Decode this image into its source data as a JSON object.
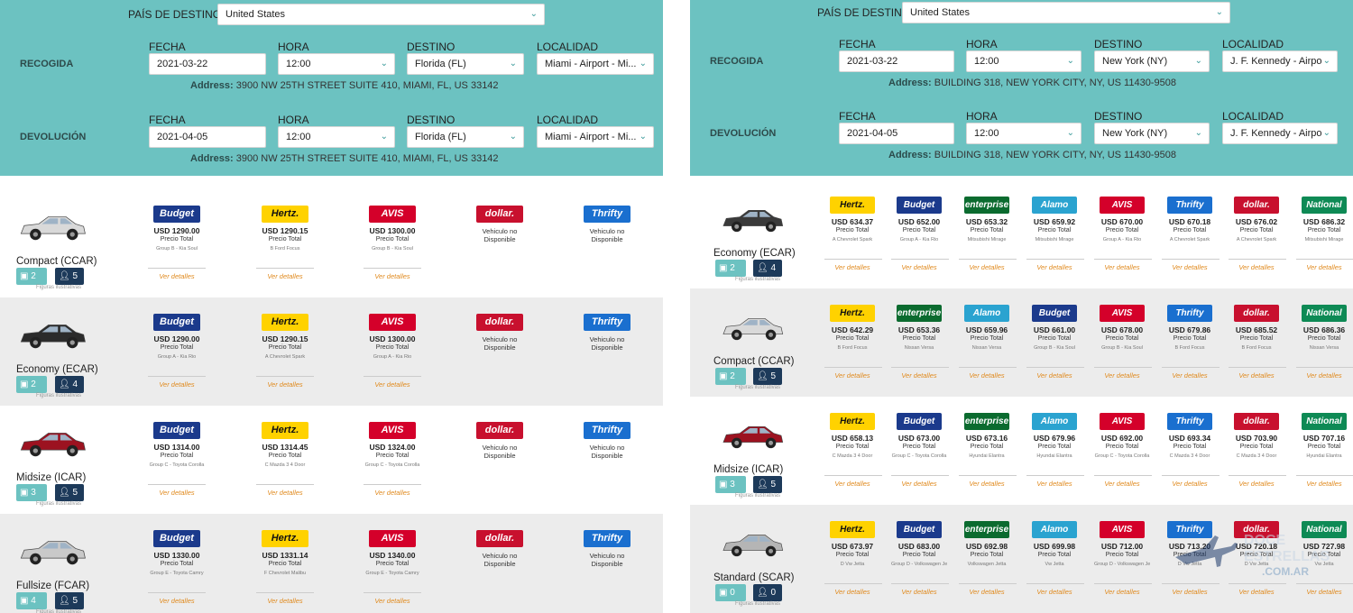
{
  "pickup_label": "RECOGIDA",
  "return_label": "DEVOLUCIÓN",
  "country_label": "PAÍS DE DESTINO",
  "col_labels": {
    "fecha": "FECHA",
    "hora": "HORA",
    "destino": "DESTINO",
    "localidad": "LOCALIDAD"
  },
  "addr_prefix": "Address:",
  "price_label": "Precio Total",
  "details_label": "Ver detalles",
  "no_vehicle_label": "Vehiculo no Disponible",
  "fig_note": "Figuras ilustrativas",
  "brands": {
    "budget": "Budget",
    "hertz": "Hertz.",
    "avis": "AVIS",
    "dollar": "dollar.",
    "thrifty": "Thrifty",
    "enterprise": "enterprise",
    "alamo": "Alamo",
    "national": "National"
  },
  "brand_colors": {
    "budget": "#1b3a8c",
    "hertz": "#ffd200",
    "avis": "#d4002a",
    "dollar": "#c8102e",
    "thrifty": "#1a6fcf",
    "enterprise": "#0b6b2f",
    "alamo": "#2aa3d0",
    "national": "#0e8a55"
  },
  "watermark": {
    "line1": "DOCE",
    "line2": "ESTRELLAS",
    "line3": ".COM.AR"
  },
  "left": {
    "country": "United States",
    "pickup": {
      "date": "2021-03-22",
      "time": "12:00",
      "dest": "Florida (FL)",
      "loc": "Miami - Airport - Mi...",
      "address": "3900 NW 25TH STREET SUITE 410, MIAMI, FL, US 33142"
    },
    "return": {
      "date": "2021-04-05",
      "time": "12:00",
      "dest": "Florida (FL)",
      "loc": "Miami - Airport - Mi...",
      "address": "3900 NW 25TH STREET SUITE 410, MIAMI, FL, US 33142"
    },
    "cars": [
      {
        "name": "Compact (CCAR)",
        "bags": "2",
        "pax": "5",
        "color": "#d9d9d9",
        "offers": [
          {
            "brand": "budget",
            "price": "USD 1290.00",
            "model": "Group B - Kia Soul"
          },
          {
            "brand": "hertz",
            "price": "USD 1290.15",
            "model": "B Ford Focus"
          },
          {
            "brand": "avis",
            "price": "USD 1300.00",
            "model": "Group B - Kia Soul"
          },
          {
            "brand": "dollar",
            "na": true
          },
          {
            "brand": "thrifty",
            "na": true
          }
        ]
      },
      {
        "name": "Economy (ECAR)",
        "bags": "2",
        "pax": "4",
        "color": "#2b2b2b",
        "offers": [
          {
            "brand": "budget",
            "price": "USD 1290.00",
            "model": "Group A - Kia Rio"
          },
          {
            "brand": "hertz",
            "price": "USD 1290.15",
            "model": "A Chevrolet Spark"
          },
          {
            "brand": "avis",
            "price": "USD 1300.00",
            "model": "Group A - Kia Rio"
          },
          {
            "brand": "dollar",
            "na": true
          },
          {
            "brand": "thrifty",
            "na": true
          }
        ]
      },
      {
        "name": "Midsize (ICAR)",
        "bags": "3",
        "pax": "5",
        "color": "#9c1220",
        "offers": [
          {
            "brand": "budget",
            "price": "USD 1314.00",
            "model": "Group C - Toyota Corolla"
          },
          {
            "brand": "hertz",
            "price": "USD 1314.45",
            "model": "C Mazda 3 4 Door"
          },
          {
            "brand": "avis",
            "price": "USD 1324.00",
            "model": "Group C - Toyota Corolla"
          },
          {
            "brand": "dollar",
            "na": true
          },
          {
            "brand": "thrifty",
            "na": true
          }
        ]
      },
      {
        "name": "Fullsize (FCAR)",
        "bags": "4",
        "pax": "5",
        "color": "#c9c9c9",
        "offers": [
          {
            "brand": "budget",
            "price": "USD 1330.00",
            "model": "Group E - Toyota Camry"
          },
          {
            "brand": "hertz",
            "price": "USD 1331.14",
            "model": "F Chevrolet Malibu"
          },
          {
            "brand": "avis",
            "price": "USD 1340.00",
            "model": "Group E - Toyota Camry"
          },
          {
            "brand": "dollar",
            "na": true
          },
          {
            "brand": "thrifty",
            "na": true
          }
        ]
      }
    ]
  },
  "right": {
    "country": "United States",
    "pickup": {
      "date": "2021-03-22",
      "time": "12:00",
      "dest": "New York (NY)",
      "loc": "J. F. Kennedy - Airpo",
      "address": "BUILDING 318, NEW YORK CITY, NY, US 11430-9508"
    },
    "return": {
      "date": "2021-04-05",
      "time": "12:00",
      "dest": "New York (NY)",
      "loc": "J. F. Kennedy - Airpo",
      "address": "BUILDING 318, NEW YORK CITY, NY, US 11430-9508"
    },
    "cars": [
      {
        "name": "Economy (ECAR)",
        "bags": "2",
        "pax": "4",
        "color": "#3a3a3a",
        "offers": [
          {
            "brand": "hertz",
            "price": "USD 634.37",
            "model": "A Chevrolet Spark"
          },
          {
            "brand": "budget",
            "price": "USD 652.00",
            "model": "Group A - Kia Rio"
          },
          {
            "brand": "enterprise",
            "price": "USD 653.32",
            "model": "Mitsubishi Mirage"
          },
          {
            "brand": "alamo",
            "price": "USD 659.92",
            "model": "Mitsubishi Mirage"
          },
          {
            "brand": "avis",
            "price": "USD 670.00",
            "model": "Group A - Kia Rio"
          },
          {
            "brand": "thrifty",
            "price": "USD 670.18",
            "model": "A Chevrolet Spark"
          },
          {
            "brand": "dollar",
            "price": "USD 676.02",
            "model": "A Chevrolet Spark"
          },
          {
            "brand": "national",
            "price": "USD 686.32",
            "model": "Mitsubishi Mirage"
          }
        ]
      },
      {
        "name": "Compact (CCAR)",
        "bags": "2",
        "pax": "5",
        "color": "#d9d9d9",
        "offers": [
          {
            "brand": "hertz",
            "price": "USD 642.29",
            "model": "B Ford Focus"
          },
          {
            "brand": "enterprise",
            "price": "USD 653.36",
            "model": "Nissan Versa"
          },
          {
            "brand": "alamo",
            "price": "USD 659.96",
            "model": "Nissan Versa"
          },
          {
            "brand": "budget",
            "price": "USD 661.00",
            "model": "Group B - Kia Soul"
          },
          {
            "brand": "avis",
            "price": "USD 678.00",
            "model": "Group B - Kia Soul"
          },
          {
            "brand": "thrifty",
            "price": "USD 679.86",
            "model": "B Ford Focus"
          },
          {
            "brand": "dollar",
            "price": "USD 685.52",
            "model": "B Ford Focus"
          },
          {
            "brand": "national",
            "price": "USD 686.36",
            "model": "Nissan Versa"
          }
        ]
      },
      {
        "name": "Midsize (ICAR)",
        "bags": "3",
        "pax": "5",
        "color": "#9c1220",
        "offers": [
          {
            "brand": "hertz",
            "price": "USD 658.13",
            "model": "C Mazda 3 4 Door"
          },
          {
            "brand": "budget",
            "price": "USD 673.00",
            "model": "Group C - Toyota Corolla"
          },
          {
            "brand": "enterprise",
            "price": "USD 673.16",
            "model": "Hyundai Elantra"
          },
          {
            "brand": "alamo",
            "price": "USD 679.96",
            "model": "Hyundai Elantra"
          },
          {
            "brand": "avis",
            "price": "USD 692.00",
            "model": "Group C - Toyota Corolla"
          },
          {
            "brand": "thrifty",
            "price": "USD 693.34",
            "model": "C Mazda 3 4 Door"
          },
          {
            "brand": "dollar",
            "price": "USD 703.90",
            "model": "C Mazda 3 4 Door"
          },
          {
            "brand": "national",
            "price": "USD 707.16",
            "model": "Hyundai Elantra"
          }
        ]
      },
      {
        "name": "Standard (SCAR)",
        "bags": "0",
        "pax": "0",
        "color": "#b5b5b5",
        "offers": [
          {
            "brand": "hertz",
            "price": "USD 673.97",
            "model": "D Vw Jetta"
          },
          {
            "brand": "budget",
            "price": "USD 683.00",
            "model": "Group D - Volkswagen Jetta"
          },
          {
            "brand": "enterprise",
            "price": "USD 692.98",
            "model": "Volkswagen Jetta"
          },
          {
            "brand": "alamo",
            "price": "USD 699.98",
            "model": "Vw Jetta"
          },
          {
            "brand": "avis",
            "price": "USD 712.00",
            "model": "Group D - Volkswagen Jetta"
          },
          {
            "brand": "thrifty",
            "price": "USD 713.20",
            "model": "D Vw Jetta"
          },
          {
            "brand": "dollar",
            "price": "USD 720.18",
            "model": "D Vw Jetta"
          },
          {
            "brand": "national",
            "price": "USD 727.98",
            "model": "Vw Jetta"
          }
        ]
      }
    ]
  }
}
